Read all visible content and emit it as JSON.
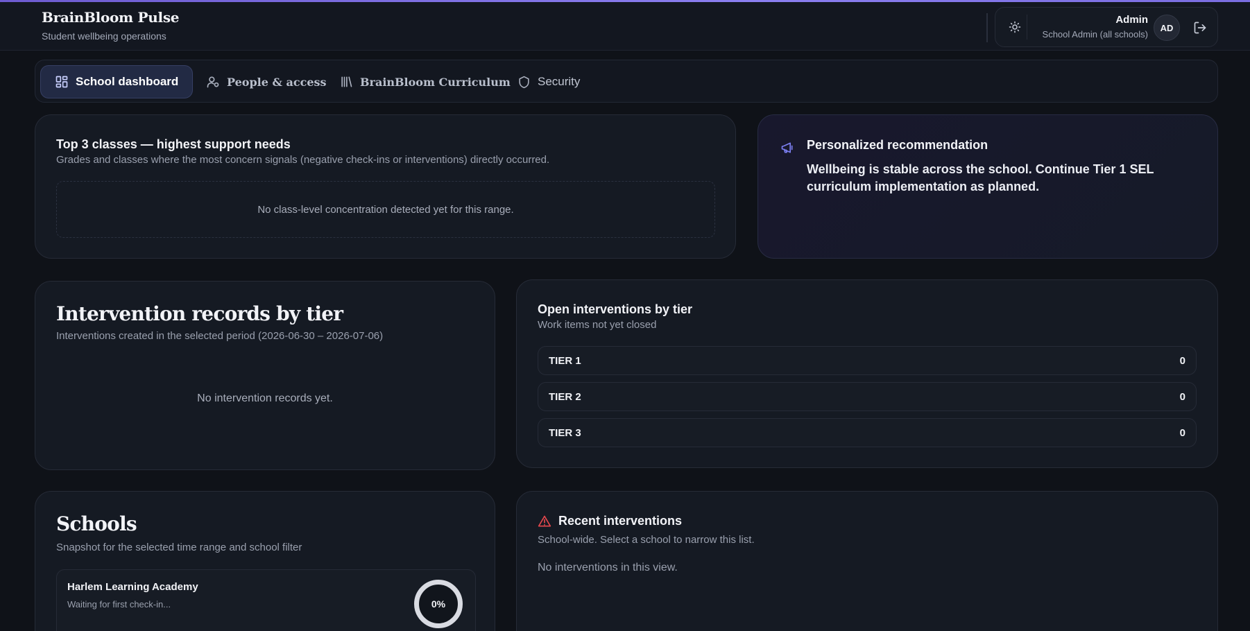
{
  "header": {
    "brand_title": "BrainBloom Pulse",
    "brand_subtitle": "Student wellbeing operations",
    "user_name": "Admin",
    "user_role": "School Admin (all schools)",
    "avatar_initials": "AD"
  },
  "tabs": [
    {
      "label": "School dashboard",
      "icon": "dashboard-grid-icon",
      "active": true
    },
    {
      "label": "People & access",
      "icon": "users-icon",
      "active": false
    },
    {
      "label": "BrainBloom Curriculum",
      "icon": "library-icon",
      "active": false
    },
    {
      "label": "Security",
      "icon": "shield-icon",
      "active": false
    }
  ],
  "top_classes": {
    "title": "Top 3 classes — highest support needs",
    "subtitle": "Grades and classes where the most concern signals (negative check-ins or interventions) directly occurred.",
    "empty_text": "No class-level concentration detected yet for this range."
  },
  "recommendation": {
    "title": "Personalized recommendation",
    "body": "Wellbeing is stable across the school. Continue Tier 1 SEL curriculum implementation as planned.",
    "icon": "megaphone-icon"
  },
  "intervention_records": {
    "title": "Intervention records by tier",
    "subtitle": "Interventions created in the selected period (2026-06-30 – 2026-07-06)",
    "empty_text": "No intervention records yet."
  },
  "open_interventions": {
    "title": "Open interventions by tier",
    "subtitle": "Work items not yet closed",
    "tiers": [
      {
        "label": "TIER 1",
        "count": "0"
      },
      {
        "label": "TIER 2",
        "count": "0"
      },
      {
        "label": "TIER 3",
        "count": "0"
      }
    ]
  },
  "schools": {
    "title": "Schools",
    "subtitle": "Snapshot for the selected time range and school filter",
    "items": [
      {
        "name": "Harlem Learning Academy",
        "status": "Waiting for first check-in...",
        "percent": "0%"
      }
    ]
  },
  "recent_interventions": {
    "title": "Recent interventions",
    "subtitle": "School-wide. Select a school to narrow this list.",
    "empty_text": "No interventions in this view.",
    "icon": "alert-triangle-icon",
    "icon_color": "#e5484d"
  }
}
